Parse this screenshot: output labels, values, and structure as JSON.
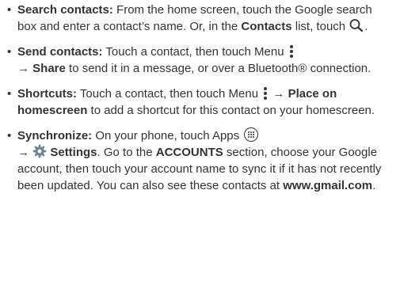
{
  "bullet": "•",
  "arrow": "→",
  "items": [
    {
      "title": "Search contacts:",
      "t1": " From the home screen, touch the Google search box and enter a contact’s name. Or, in the ",
      "b1": "Contacts",
      "t2": " list, touch ",
      "t3": ".",
      "icon": "search-icon"
    },
    {
      "title": "Send contacts:",
      "t1": " Touch a contact, then touch Menu ",
      "b1": "Share",
      "t2": " to send it in a message, or over a Bluetooth® connection.",
      "icon": "menu-icon"
    },
    {
      "title": "Shortcuts:",
      "t1": " Touch a contact, then touch Menu ",
      "b1": "Place on homescreen",
      "t2": " to add a shortcut for this contact on your homescreen.",
      "icon": "menu-icon"
    },
    {
      "title": "Synchronize:",
      "t1": " On your phone, touch Apps ",
      "b1": "Settings",
      "t2": ". Go to the ",
      "b2": "ACCOUNTS",
      "t3": " section, choose your Google account, then touch your account name to sync it if it has not recently been updated. You can also see these contacts at ",
      "b3": "www.gmail.com",
      "t4": ".",
      "icons": [
        "apps-icon",
        "settings-gear-icon"
      ]
    }
  ]
}
